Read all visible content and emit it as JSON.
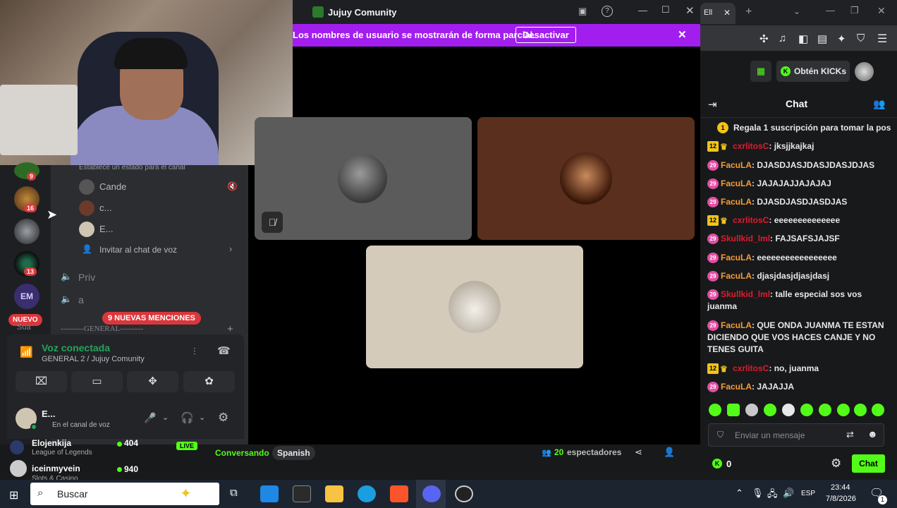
{
  "discord": {
    "window_title": "Jujuy Comunity",
    "banner": {
      "text": "Los nombres de usuario se mostrarán de forma parcial.",
      "button": "Desactivar"
    },
    "servers": [
      {
        "badge": "9"
      },
      {
        "badge": "16"
      },
      {
        "badge": ""
      },
      {
        "badge": "13"
      },
      {
        "badge": ""
      }
    ],
    "new_label": "NUEVO",
    "status_hint": "Establece un estado para el canal",
    "voice_members": [
      "Cande",
      "c...",
      "E..."
    ],
    "invite_label": "Invitar al chat de voz",
    "channels": [
      "Priv",
      "a"
    ],
    "category": "---------GENERAL---------",
    "category_prefix": "Sua",
    "mentions": "9 NUEVAS MENCIONES",
    "voice": {
      "status": "Voz conectada",
      "channel": "GENERAL 2 / Jujuy Comunity"
    },
    "user": {
      "name": "E...",
      "status": "En el canal de voz"
    }
  },
  "stream_bar": {
    "live": "LIVE",
    "category": "Conversando",
    "language": "Spanish",
    "viewers_count": "20",
    "viewers_label": "espectadores",
    "recommended": [
      {
        "name": "Elojenkija",
        "game": "League of Legends",
        "viewers": "404"
      },
      {
        "name": "iceinmyvein",
        "game": "Slots & Casino",
        "viewers": "940"
      }
    ]
  },
  "browser": {
    "tab_title": "Ell",
    "kicks_button": "Obtén KICKs"
  },
  "chat": {
    "title": "Chat",
    "pinned": "Regala 1 suscripción para tomar la pos",
    "messages": [
      {
        "badge": "12",
        "crown": true,
        "user": "cxrlitosC",
        "user_color": "#e01b2d",
        "text": "jksjjkajkaj"
      },
      {
        "badge": "29",
        "crown": false,
        "user": "FacuLA",
        "user_color": "#f79c35",
        "text": "DJASDJASJDASJDASJDJAS"
      },
      {
        "badge": "29",
        "crown": false,
        "user": "FacuLA",
        "user_color": "#f79c35",
        "text": "JAJAJAJJAJAJAJ"
      },
      {
        "badge": "29",
        "crown": false,
        "user": "FacuLA",
        "user_color": "#f79c35",
        "text": "DJASDJASDJASDJAS"
      },
      {
        "badge": "12",
        "crown": true,
        "user": "cxrlitosC",
        "user_color": "#e01b2d",
        "text": "eeeeeeeeeeeeee"
      },
      {
        "badge": "29",
        "crown": false,
        "user": "Skullkid_lml",
        "user_color": "#e01b2d",
        "text": "FAJSAFSJAJSF"
      },
      {
        "badge": "29",
        "crown": false,
        "user": "FacuLA",
        "user_color": "#f79c35",
        "text": "eeeeeeeeeeeeeeeee"
      },
      {
        "badge": "29",
        "crown": false,
        "user": "FacuLA",
        "user_color": "#f79c35",
        "text": "djasjdasjdjasjdasj"
      },
      {
        "badge": "29",
        "crown": false,
        "user": "Skullkid_lml",
        "user_color": "#e01b2d",
        "text": "talle especial sos vos juanma"
      },
      {
        "badge": "29",
        "crown": false,
        "user": "FacuLA",
        "user_color": "#f79c35",
        "text": "QUE ONDA JUANMA TE ESTAN DICIENDO QUE VOS HACES CANJE Y NO TENES GUITA"
      },
      {
        "badge": "12",
        "crown": true,
        "user": "cxrlitosC",
        "user_color": "#e01b2d",
        "text": "no, juanma"
      },
      {
        "badge": "29",
        "crown": false,
        "user": "FacuLA",
        "user_color": "#f79c35",
        "text": "JAJAJJA"
      }
    ],
    "input_placeholder": "Enviar un mensaje",
    "kicks_count": "0",
    "send_button": "Chat"
  },
  "taskbar": {
    "search": "Buscar",
    "lang": "ESP",
    "time": "23:44",
    "date": "7/8/2026",
    "notifications": "1"
  }
}
